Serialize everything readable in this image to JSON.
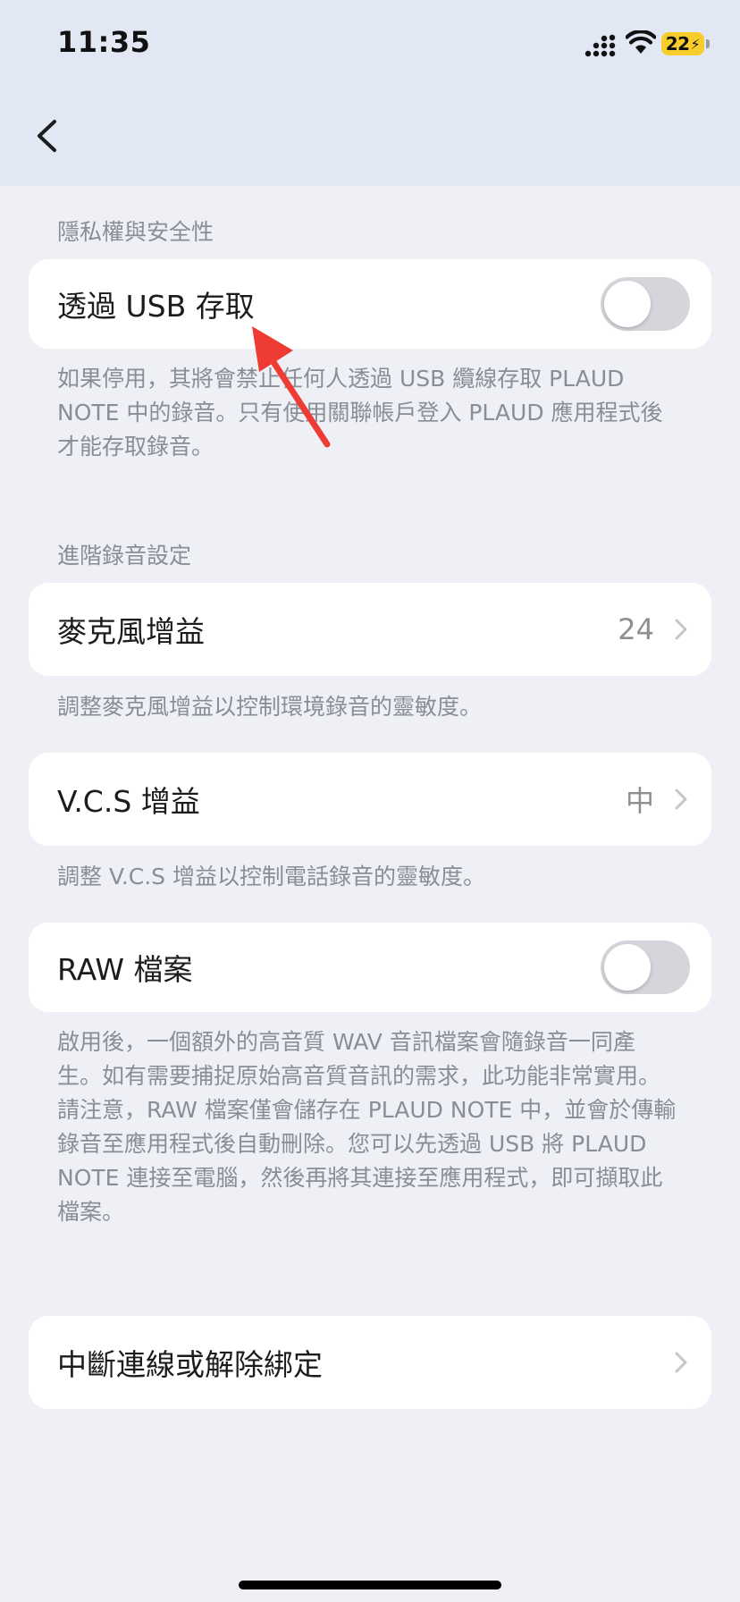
{
  "status_bar": {
    "time": "11:35",
    "battery": "22"
  },
  "nav": {
    "back_icon": "chevron-left-icon"
  },
  "privacy": {
    "section_title": "隱私權與安全性",
    "usb_access_label": "透過 USB 存取",
    "usb_access_enabled": false,
    "usb_desc_lines": [
      "如果停用，其將會禁止任何人透過 USB 纜線存取 PLAUD",
      "NOTE 中的錄音。只有使用關聯帳戶登入 PLAUD 應用程式後",
      "才能存取錄音。"
    ]
  },
  "advanced": {
    "section_title": "進階錄音設定",
    "mic_gain_label": "麥克風增益",
    "mic_gain_value": "24",
    "mic_gain_desc": "調整麥克風增益以控制環境錄音的靈敏度。",
    "vcs_gain_label": "V.C.S 增益",
    "vcs_gain_value": "中",
    "vcs_gain_desc": "調整 V.C.S 增益以控制電話錄音的靈敏度。",
    "raw_label": "RAW 檔案",
    "raw_enabled": false,
    "raw_desc_lines": [
      "啟用後，一個額外的高音質 WAV 音訊檔案會隨錄音一同產",
      "生。如有需要捕捉原始高音質音訊的需求，此功能非常實用。",
      "請注意，RAW 檔案僅會儲存在 PLAUD NOTE 中，並會於傳輸",
      "錄音至應用程式後自動刪除。您可以先透過 USB 將 PLAUD",
      "NOTE 連接至電腦，然後再將其連接至應用程式，即可擷取此",
      "檔案。"
    ]
  },
  "disconnect_label": "中斷連線或解除綁定",
  "colors": {
    "background": "#eff0f6",
    "header": "#e2e7f4",
    "card": "#ffffff",
    "secondary_text": "#8a8d96",
    "toggle_off": "#d4d6dc",
    "battery": "#f6cd2a",
    "annotation_arrow": "#ee3b33"
  }
}
